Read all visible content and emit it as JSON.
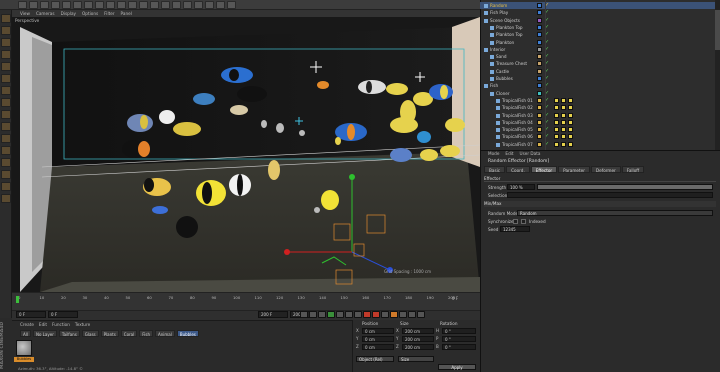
{
  "menu": {
    "items": [
      "View",
      "Cameras",
      "Display",
      "Options",
      "Filter",
      "Panel"
    ]
  },
  "viewport": {
    "label": "Perspective",
    "info": "Grid Spacing : 1000 cm"
  },
  "timeline": {
    "ticks": [
      "0",
      "10",
      "20",
      "30",
      "40",
      "50",
      "60",
      "70",
      "80",
      "90",
      "100",
      "110",
      "120",
      "130",
      "140",
      "150",
      "160",
      "170",
      "180",
      "190",
      "200"
    ],
    "end_label": "0 F",
    "start_field": "0 F",
    "current_field": "0 F",
    "end_field": "200 F",
    "max_field": "200 F"
  },
  "material": {
    "menu": [
      "Create",
      "Edit",
      "Function",
      "Texture"
    ],
    "tags": [
      "All",
      "No Layer",
      "Tailfans",
      "Glass",
      "Plants",
      "Coral",
      "Fish",
      "Animal",
      "Bubbles"
    ],
    "active_tag": "Bubbles",
    "thumb_label": "Bubbles",
    "logo": "MAXON CINEMA4D"
  },
  "status": {
    "text": "Azimuth: 36.3°, Altitude: -14.8°  ©"
  },
  "coordinates": {
    "headers": [
      "Position",
      "Size",
      "Rotation"
    ],
    "axes": [
      "X",
      "Y",
      "Z"
    ],
    "position": [
      "0 cm",
      "0 cm",
      "0 cm"
    ],
    "size": [
      "200 cm",
      "200 cm",
      "200 cm"
    ],
    "rot_labels": [
      "H",
      "P",
      "B"
    ],
    "rotation": [
      "0 °",
      "0 °",
      "0 °"
    ],
    "object_mode": "Object (Rel)",
    "size_mode": "Size",
    "apply_label": "Apply"
  },
  "object_manager": {
    "rows": [
      {
        "label": "Random",
        "depth": 0,
        "selected": true,
        "tag_color": "#3e7fd6"
      },
      {
        "label": "Fish Play",
        "depth": 0,
        "selected": false,
        "tag_color": "#3e7fd6"
      },
      {
        "label": "Scene Objects",
        "depth": 0,
        "selected": false,
        "tag_color": "#9a5bc2"
      },
      {
        "label": "Plankton Top",
        "depth": 1,
        "selected": false,
        "tag_color": "#3e7fd6"
      },
      {
        "label": "Plankton Top",
        "depth": 1,
        "selected": false,
        "tag_color": "#3e7fd6"
      },
      {
        "label": "Plankton",
        "depth": 1,
        "selected": false,
        "tag_color": "#3e7fd6"
      },
      {
        "label": "Interior",
        "depth": 0,
        "selected": false,
        "tag_color": "#9a9a9a"
      },
      {
        "label": "Sand",
        "depth": 1,
        "selected": false,
        "tag_color": "#c7a36a"
      },
      {
        "label": "Treasure Chest",
        "depth": 1,
        "selected": false,
        "tag_color": "#c7a36a"
      },
      {
        "label": "Castle",
        "depth": 1,
        "selected": false,
        "tag_color": "#c7a36a"
      },
      {
        "label": "Bubbles",
        "depth": 1,
        "selected": false,
        "tag_color": "#3e7fd6"
      },
      {
        "label": "Fish",
        "depth": 0,
        "selected": false,
        "tag_color": "#3e7fd6"
      },
      {
        "label": "Cloner",
        "depth": 1,
        "selected": false,
        "tag_color": "#3fc0c0"
      },
      {
        "label": "TropicalFish 01",
        "depth": 2,
        "selected": false,
        "tag_color": "#d9b34a"
      },
      {
        "label": "TropicalFish 02",
        "depth": 2,
        "selected": false,
        "tag_color": "#d9b34a"
      },
      {
        "label": "TropicalFish 03",
        "depth": 2,
        "selected": false,
        "tag_color": "#d9b34a"
      },
      {
        "label": "TropicalFish 04",
        "depth": 2,
        "selected": false,
        "tag_color": "#d9b34a"
      },
      {
        "label": "TropicalFish 05",
        "depth": 2,
        "selected": false,
        "tag_color": "#d9b34a"
      },
      {
        "label": "TropicalFish 06",
        "depth": 2,
        "selected": false,
        "tag_color": "#d9b34a"
      },
      {
        "label": "TropicalFish 07",
        "depth": 2,
        "selected": false,
        "tag_color": "#d9b34a"
      }
    ]
  },
  "attributes": {
    "menu": [
      "Mode",
      "Edit",
      "User Data"
    ],
    "title": "Random Effector [Random]",
    "tabs": [
      "Basic",
      "Coord.",
      "Effector",
      "Parameter",
      "Deformer",
      "Falloff"
    ],
    "active_tab": "Effector",
    "section": "Effector",
    "strength_label": "Strength",
    "strength_value": "100 %",
    "selection_label": "Selection",
    "minmax_label": "Min/Max",
    "random_mode_label": "Random Mode",
    "random_mode_value": "Random",
    "synchronized_label": "Synchronized",
    "indexed_label": "Indexed",
    "seed_label": "Seed",
    "seed_value": "12345",
    "strength_fraction": 1.0
  },
  "colors": {
    "accent": "#3b5277",
    "selected_text": "#f0c240"
  }
}
